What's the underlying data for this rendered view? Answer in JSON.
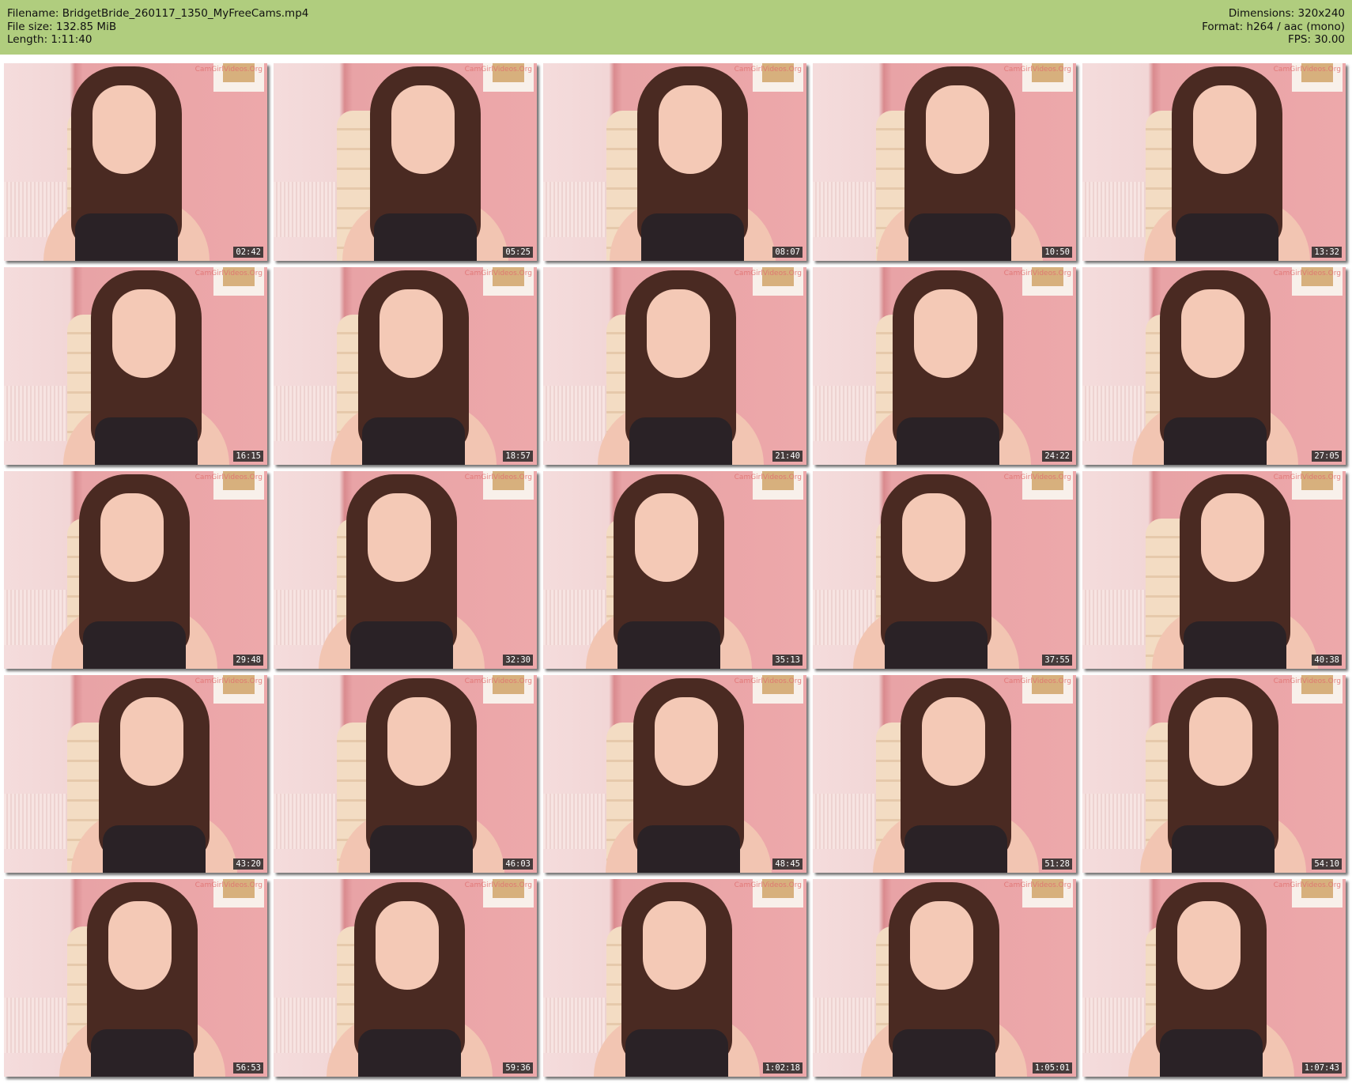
{
  "header": {
    "filename": "Filename: BridgetBride_260117_1350_MyFreeCams.mp4",
    "file_size": "File size: 132.85 MiB",
    "length": "Length: 1:11:40",
    "dimensions": "Dimensions: 320x240",
    "format": "Format: h264 / aac (mono)",
    "fps": "FPS: 30.00"
  },
  "watermark": "CamGirlVideos.Org",
  "thumbnails": [
    {
      "timestamp": "02:42"
    },
    {
      "timestamp": "05:25"
    },
    {
      "timestamp": "08:07"
    },
    {
      "timestamp": "10:50"
    },
    {
      "timestamp": "13:32"
    },
    {
      "timestamp": "16:15"
    },
    {
      "timestamp": "18:57"
    },
    {
      "timestamp": "21:40"
    },
    {
      "timestamp": "24:22"
    },
    {
      "timestamp": "27:05"
    },
    {
      "timestamp": "29:48"
    },
    {
      "timestamp": "32:30"
    },
    {
      "timestamp": "35:13"
    },
    {
      "timestamp": "37:55"
    },
    {
      "timestamp": "40:38"
    },
    {
      "timestamp": "43:20"
    },
    {
      "timestamp": "46:03"
    },
    {
      "timestamp": "48:45"
    },
    {
      "timestamp": "51:28"
    },
    {
      "timestamp": "54:10"
    },
    {
      "timestamp": "56:53"
    },
    {
      "timestamp": "59:36"
    },
    {
      "timestamp": "1:02:18"
    },
    {
      "timestamp": "1:05:01"
    },
    {
      "timestamp": "1:07:43"
    }
  ]
}
